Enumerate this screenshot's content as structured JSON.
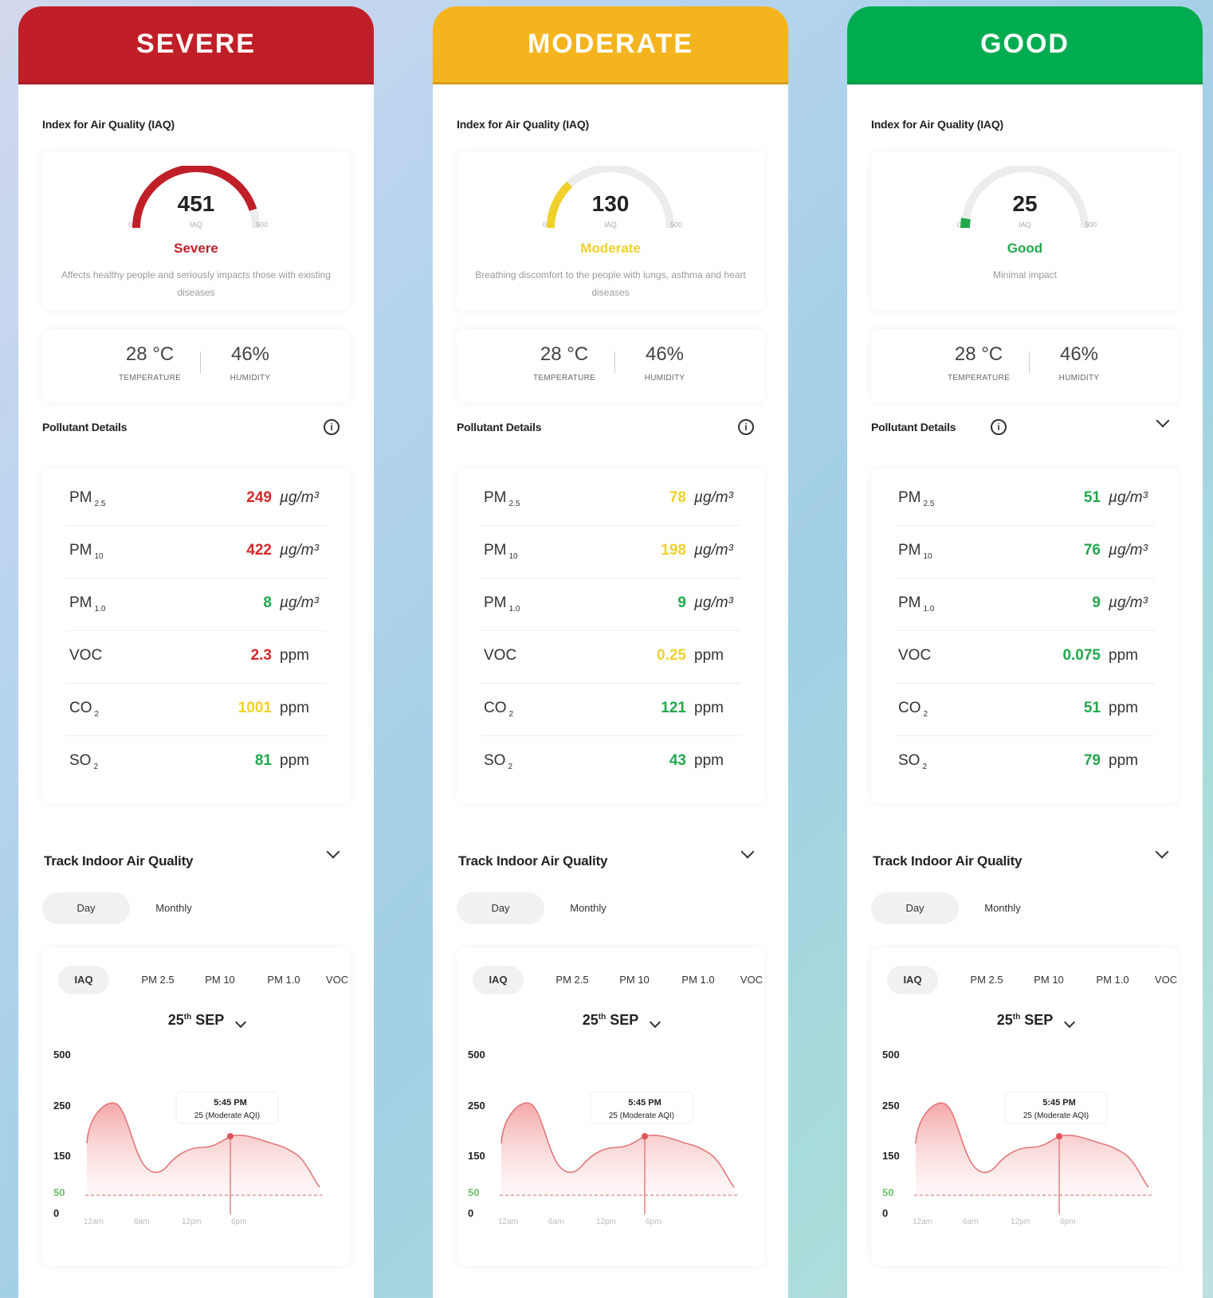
{
  "cards": [
    {
      "header": "SEVERE",
      "accent": "#c01f28",
      "iaq_title": "Index for Air Quality (IAQ)",
      "gauge": {
        "value": "451",
        "level": 451,
        "max_level": 500,
        "unit": "IAQ",
        "min_label": "0",
        "max_label": "500"
      },
      "status": "Severe",
      "status_color": "#c01f28",
      "description": "Affects healthy people and seriously impacts those with existing diseases",
      "temperature": "28 °C",
      "temperature_label": "TEMPERATURE",
      "humidity": "46%",
      "humidity_label": "HUMIDITY",
      "pollutant_title": "Pollutant Details",
      "pollutants": [
        {
          "name": "PM",
          "sub": "2.5",
          "value": "249",
          "color": "#d32a2a",
          "unit": "µg/m³"
        },
        {
          "name": "PM",
          "sub": "10",
          "value": "422",
          "color": "#d32a2a",
          "unit": "µg/m³"
        },
        {
          "name": "PM",
          "sub": "1.0",
          "value": "8",
          "color": "#21a84c",
          "unit": "µg/m³"
        },
        {
          "name": "VOC",
          "sub": "",
          "value": "2.3",
          "color": "#d32a2a",
          "unit": "ppm"
        },
        {
          "name": "CO",
          "sub": "2",
          "value": "1001",
          "color": "#f0d12a",
          "unit": "ppm"
        },
        {
          "name": "SO",
          "sub": "2",
          "value": "81",
          "color": "#21a84c",
          "unit": "ppm"
        }
      ],
      "track_title": "Track Indoor Air Quality",
      "segments": [
        "Day",
        "Monthly"
      ],
      "metric_tabs": [
        "IAQ",
        "PM 2.5",
        "PM 10",
        "PM 1.0",
        "VOC"
      ],
      "date": {
        "day": "25",
        "suffix": "th",
        "month": "SEP"
      },
      "chart_data": {
        "type": "area",
        "y_ticks": [
          "500",
          "250",
          "150",
          "50",
          "0"
        ],
        "x_ticks": [
          "12am",
          "6am",
          "12pm",
          "6pm"
        ],
        "threshold": 50,
        "tooltip": {
          "time": "5:45 PM",
          "text": "25 (Moderate AQI)"
        }
      }
    },
    {
      "header": "MODERATE",
      "accent": "#f4b41e",
      "iaq_title": "Index for Air Quality (IAQ)",
      "gauge": {
        "value": "130",
        "level": 130,
        "max_level": 500,
        "unit": "IAQ",
        "min_label": "0",
        "max_label": "500"
      },
      "status": "Moderate",
      "status_color": "#f0d12a",
      "description": "Breathing discomfort to the people with lungs, asthma and heart diseases",
      "temperature": "28 °C",
      "temperature_label": "TEMPERATURE",
      "humidity": "46%",
      "humidity_label": "HUMIDITY",
      "pollutant_title": "Pollutant Details",
      "pollutants": [
        {
          "name": "PM",
          "sub": "2.5",
          "value": "78",
          "color": "#f0d12a",
          "unit": "µg/m³"
        },
        {
          "name": "PM",
          "sub": "10",
          "value": "198",
          "color": "#f0d12a",
          "unit": "µg/m³"
        },
        {
          "name": "PM",
          "sub": "1.0",
          "value": "9",
          "color": "#21a84c",
          "unit": "µg/m³"
        },
        {
          "name": "VOC",
          "sub": "",
          "value": "0.25",
          "color": "#f0d12a",
          "unit": "ppm"
        },
        {
          "name": "CO",
          "sub": "2",
          "value": "121",
          "color": "#21a84c",
          "unit": "ppm"
        },
        {
          "name": "SO",
          "sub": "2",
          "value": "43",
          "color": "#21a84c",
          "unit": "ppm"
        }
      ],
      "track_title": "Track Indoor Air Quality",
      "segments": [
        "Day",
        "Monthly"
      ],
      "metric_tabs": [
        "IAQ",
        "PM 2.5",
        "PM 10",
        "PM 1.0",
        "VOC"
      ],
      "date": {
        "day": "25",
        "suffix": "th",
        "month": "SEP"
      },
      "chart_data": {
        "type": "area",
        "y_ticks": [
          "500",
          "250",
          "150",
          "50",
          "0"
        ],
        "x_ticks": [
          "12am",
          "6am",
          "12pm",
          "6pm"
        ],
        "threshold": 50,
        "tooltip": {
          "time": "5:45 PM",
          "text": "25 (Moderate AQI)"
        }
      }
    },
    {
      "header": "GOOD",
      "accent": "#00ac4f",
      "iaq_title": "Index for Air Quality (IAQ)",
      "gauge": {
        "value": "25",
        "level": 25,
        "max_level": 500,
        "unit": "IAQ",
        "min_label": "0",
        "max_label": "500"
      },
      "status": "Good",
      "status_color": "#21a84c",
      "description": "Minimal impact",
      "temperature": "28 °C",
      "temperature_label": "TEMPERATURE",
      "humidity": "46%",
      "humidity_label": "HUMIDITY",
      "pollutant_title": "Pollutant Details",
      "pollutants": [
        {
          "name": "PM",
          "sub": "2.5",
          "value": "51",
          "color": "#21a84c",
          "unit": "µg/m³"
        },
        {
          "name": "PM",
          "sub": "10",
          "value": "76",
          "color": "#21a84c",
          "unit": "µg/m³"
        },
        {
          "name": "PM",
          "sub": "1.0",
          "value": "9",
          "color": "#21a84c",
          "unit": "µg/m³"
        },
        {
          "name": "VOC",
          "sub": "",
          "value": "0.075",
          "color": "#21a84c",
          "unit": "ppm"
        },
        {
          "name": "CO",
          "sub": "2",
          "value": "51",
          "color": "#21a84c",
          "unit": "ppm"
        },
        {
          "name": "SO",
          "sub": "2",
          "value": "79",
          "color": "#21a84c",
          "unit": "ppm"
        }
      ],
      "track_title": "Track Indoor Air Quality",
      "segments": [
        "Day",
        "Monthly"
      ],
      "metric_tabs": [
        "IAQ",
        "PM 2.5",
        "PM 10",
        "PM 1.0",
        "VOC"
      ],
      "date": {
        "day": "25",
        "suffix": "th",
        "month": "SEP"
      },
      "chart_data": {
        "type": "area",
        "y_ticks": [
          "500",
          "250",
          "150",
          "50",
          "0"
        ],
        "x_ticks": [
          "12am",
          "6am",
          "12pm",
          "6pm"
        ],
        "threshold": 50,
        "tooltip": {
          "time": "5:45 PM",
          "text": "25 (Moderate AQI)"
        }
      }
    }
  ]
}
